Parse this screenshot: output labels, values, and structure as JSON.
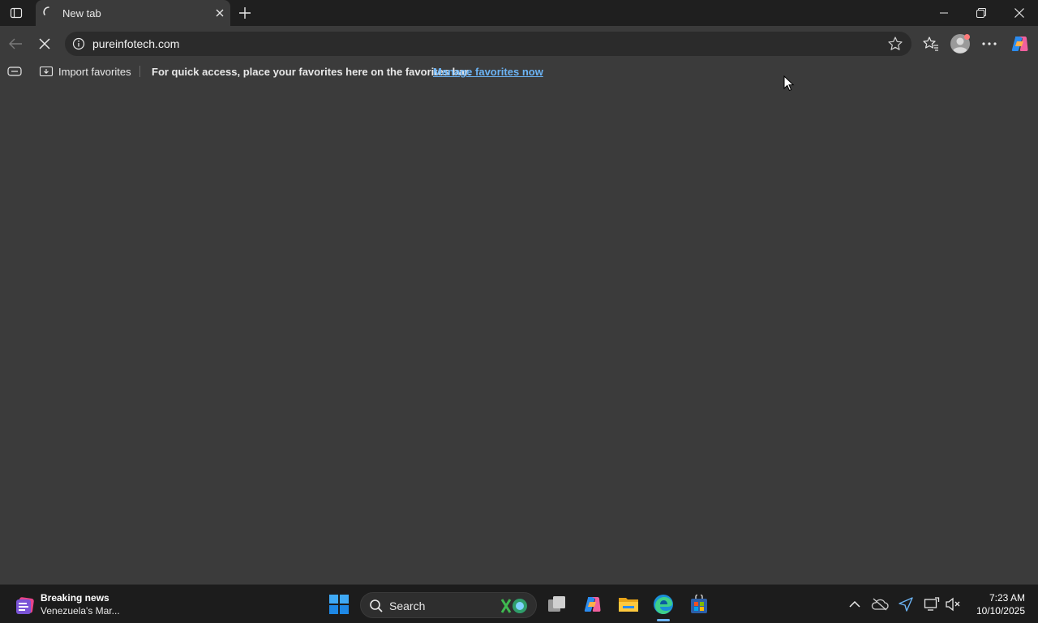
{
  "browser": {
    "tab": {
      "title": "New tab"
    },
    "address": {
      "url": "pureinfotech.com"
    },
    "favorites_bar": {
      "import_label": "Import favorites",
      "hint": "For quick access, place your favorites here on the favorites bar.",
      "manage_link": "Manage favorites now"
    }
  },
  "taskbar": {
    "news": {
      "title": "Breaking news",
      "subtitle": "Venezuela's Mar..."
    },
    "search_label": "Search",
    "clock": {
      "time": "7:23 AM",
      "date": "10/10/2025"
    },
    "pinned": [
      "task-view",
      "copilot",
      "file-explorer",
      "edge",
      "microsoft-store"
    ]
  },
  "colors": {
    "accent": "#6cb4f5",
    "page_bg": "#3b3b3b",
    "titlebar_bg": "#1f1f1f",
    "taskbar_bg": "#1c1c1c"
  }
}
